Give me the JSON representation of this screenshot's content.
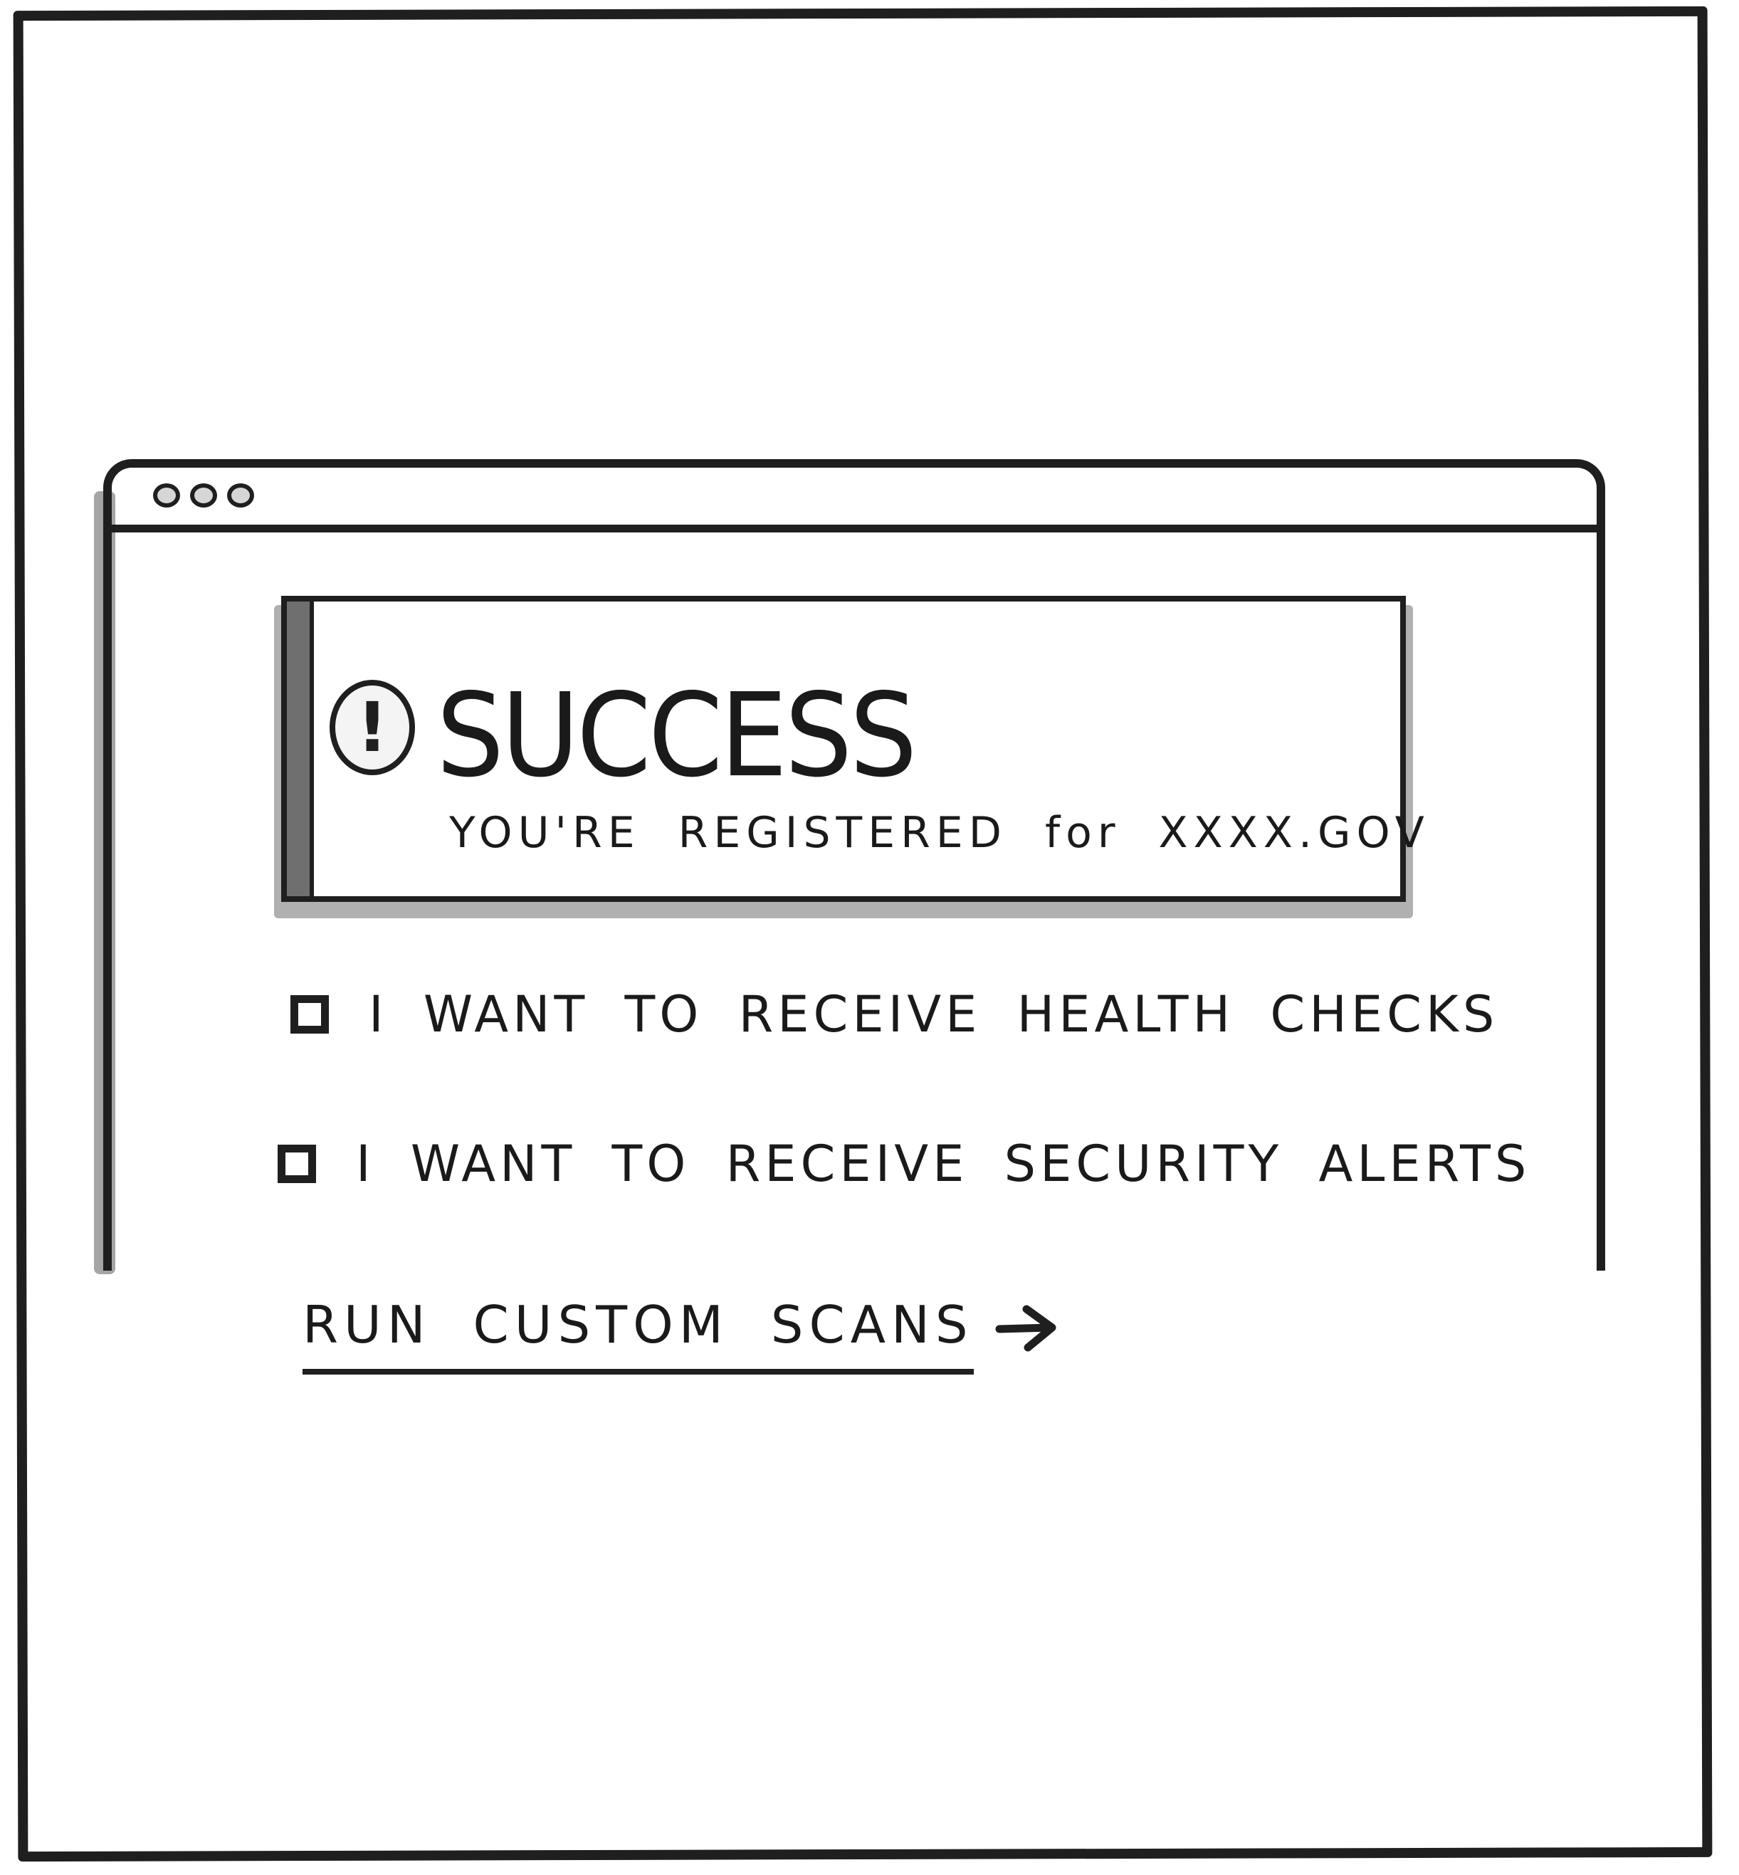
{
  "alert": {
    "icon": "exclamation-icon",
    "icon_glyph": "!",
    "title": "SUCCESS",
    "message": "YOU'RE REGISTERED for XXXX.GOV"
  },
  "options": [
    {
      "label": "I WANT TO RECEIVE HEALTH CHECKS",
      "checked": false
    },
    {
      "label": "I WANT TO RECEIVE SECURITY ALERTS",
      "checked": false
    }
  ],
  "link": {
    "label": "RUN CUSTOM SCANS",
    "icon": "arrow-right-icon"
  },
  "colors": {
    "ink": "#1f1f1f",
    "accent_gray": "#6f6f6f",
    "shadow_gray": "#b0b0b0"
  }
}
